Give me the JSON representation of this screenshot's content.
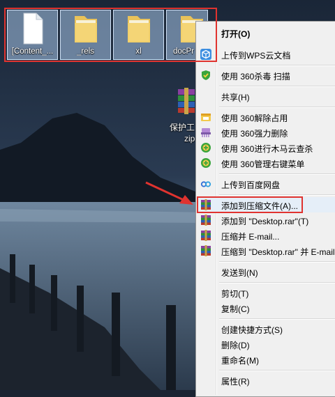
{
  "desktop": {
    "selected_icons": [
      {
        "label": "[Content_...",
        "icon": "document-icon"
      },
      {
        "label": "_rels",
        "icon": "folder-icon"
      },
      {
        "label": "xl",
        "icon": "folder-icon"
      },
      {
        "label": "docPr",
        "icon": "folder-icon"
      }
    ],
    "zip_icon": {
      "label_line1": "保护工",
      "label_line2": "zip",
      "icon": "winrar-archive-icon"
    }
  },
  "context_menu": {
    "items": [
      {
        "label": "打开(O)",
        "icon": "",
        "bold": true
      },
      {
        "label": "上传到WPS云文档",
        "icon": "wps-cloud-icon"
      },
      {
        "label": "使用 360杀毒 扫描",
        "icon": "360-shield-icon"
      },
      {
        "label": "共享(H)",
        "icon": ""
      },
      {
        "label": "使用 360解除占用",
        "icon": "360-unlock-icon"
      },
      {
        "label": "使用 360强力删除",
        "icon": "360-shred-icon"
      },
      {
        "label": "使用 360进行木马云查杀",
        "icon": "360-trojan-icon"
      },
      {
        "label": "使用 360管理右键菜单",
        "icon": "360-menu-icon"
      },
      {
        "label": "上传到百度网盘",
        "icon": "baidu-netdisk-icon"
      },
      {
        "label": "添加到压缩文件(A)...",
        "icon": "winrar-icon"
      },
      {
        "label": "添加到 \"Desktop.rar\"(T)",
        "icon": "winrar-icon"
      },
      {
        "label": "压缩并 E-mail...",
        "icon": "winrar-icon"
      },
      {
        "label": "压缩到 \"Desktop.rar\" 并 E-mail",
        "icon": "winrar-icon"
      },
      {
        "label": "发送到(N)",
        "icon": ""
      },
      {
        "label": "剪切(T)",
        "icon": ""
      },
      {
        "label": "复制(C)",
        "icon": ""
      },
      {
        "label": "创建快捷方式(S)",
        "icon": ""
      },
      {
        "label": "删除(D)",
        "icon": ""
      },
      {
        "label": "重命名(M)",
        "icon": ""
      },
      {
        "label": "属性(R)",
        "icon": ""
      }
    ]
  },
  "colors": {
    "highlight_frame": "#e0332f",
    "menu_background": "#f0f0f0",
    "selection_fill": "#aac8eb"
  }
}
